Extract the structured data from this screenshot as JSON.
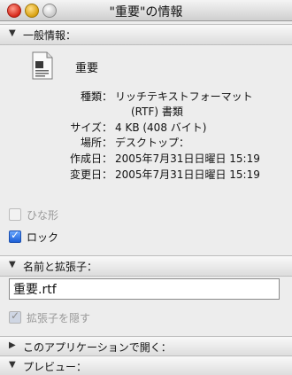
{
  "window": {
    "title": "\"重要\"の情報"
  },
  "sections": {
    "general": "一般情報：",
    "name_ext": "名前と拡張子：",
    "open_with": "このアプリケーションで開く：",
    "preview": "プレビュー："
  },
  "file": {
    "name": "重要",
    "icon": "rtf-document-icon"
  },
  "general_info": {
    "kind_label": "種類：",
    "kind_value": "リッチテキストフォーマット",
    "kind_value_cont": "(RTF) 書類",
    "size_label": "サイズ：",
    "size_value": "4 KB (408 バイト)",
    "location_label": "場所：",
    "location_value": "デスクトップ：",
    "created_label": "作成日：",
    "created_value": "2005年7月31日日曜日 15:19",
    "modified_label": "変更日：",
    "modified_value": "2005年7月31日日曜日 15:19"
  },
  "checkboxes": {
    "stationery_label": "ひな形",
    "stationery_checked": false,
    "locked_label": "ロック",
    "locked_checked": true,
    "hide_ext_label": "拡張子を隠す",
    "hide_ext_checked": true
  },
  "name_field": {
    "value": "重要.rtf"
  },
  "colors": {
    "checkbox_accent": "#1c5fd6",
    "close_button": "#d6281a",
    "minimize_button": "#d8a010"
  }
}
